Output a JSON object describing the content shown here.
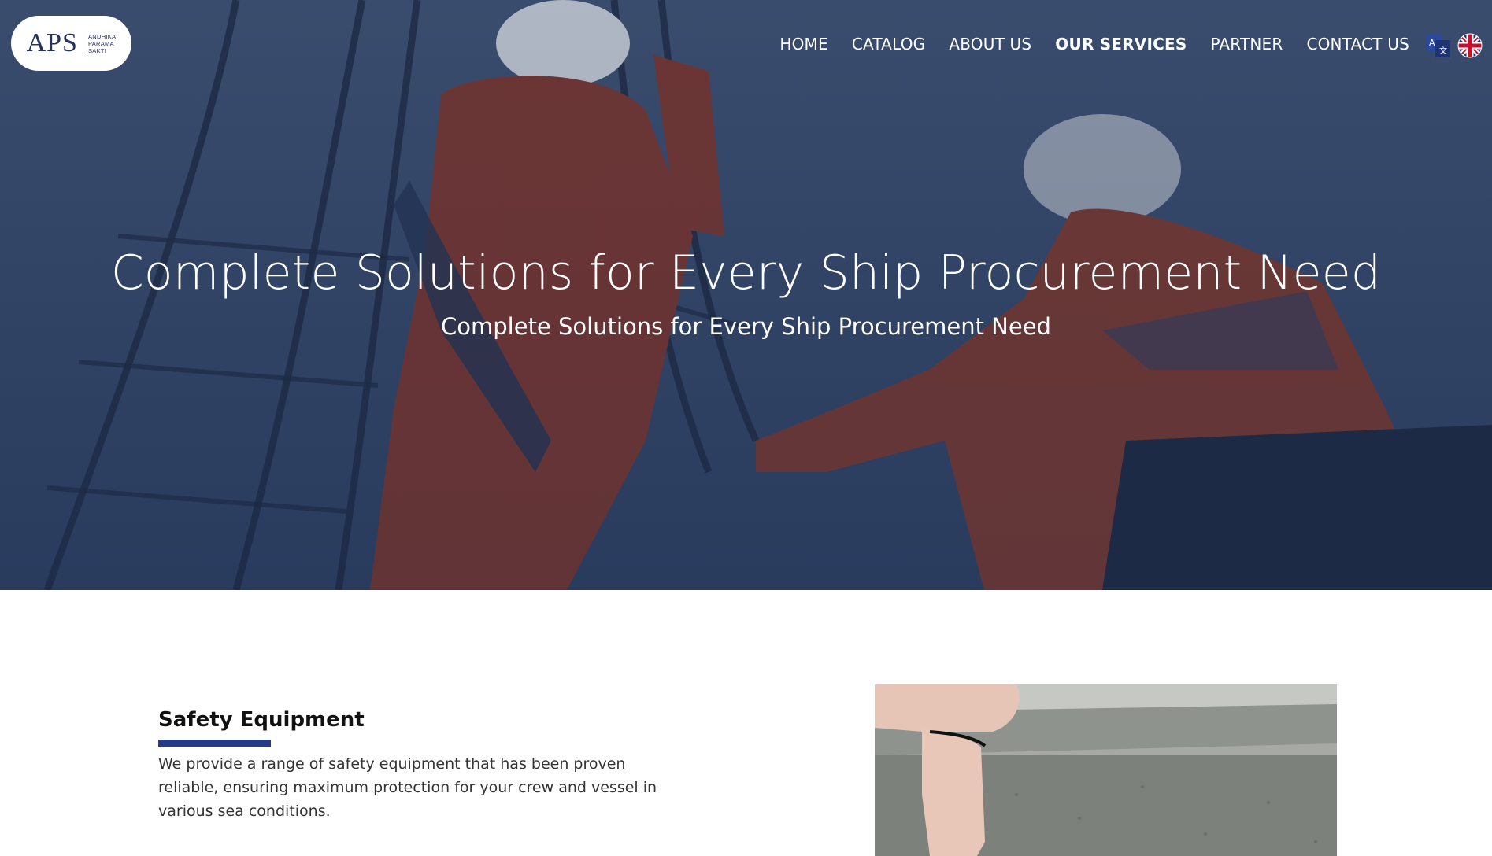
{
  "brand": {
    "logo_mark": "APS",
    "logo_sub": [
      "ANDHIKA",
      "PARAMA",
      "SAKTI"
    ]
  },
  "nav": {
    "items": [
      {
        "label": "HOME",
        "active": false
      },
      {
        "label": "CATALOG",
        "active": false
      },
      {
        "label": "ABOUT US",
        "active": false
      },
      {
        "label": "OUR SERVICES",
        "active": true
      },
      {
        "label": "PARTNER",
        "active": false
      },
      {
        "label": "CONTACT US",
        "active": false
      }
    ]
  },
  "language": {
    "translate_icon": "translate-icon",
    "flag_icon": "uk-flag-icon"
  },
  "hero": {
    "title": "Complete Solutions for Every Ship Procurement Need",
    "subtitle": "Complete Solutions for Every Ship Procurement Need",
    "overlay_color": "#2c3f66"
  },
  "section": {
    "title": "Safety Equipment",
    "text": "We provide a range of safety equipment that has been proven reliable, ensuring maximum protection for your crew and vessel in various sea conditions.",
    "accent_color": "#263a88"
  }
}
